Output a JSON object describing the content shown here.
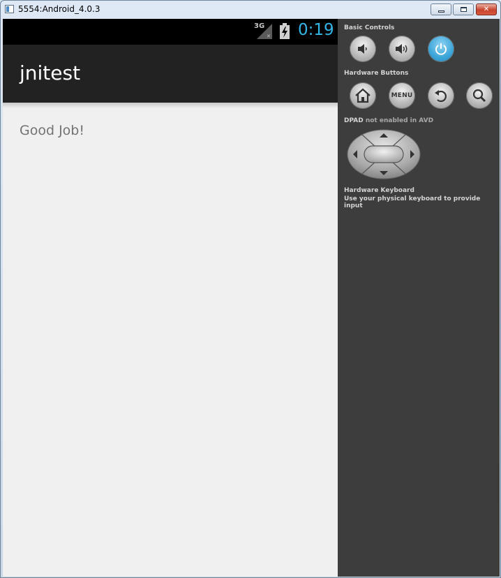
{
  "window": {
    "title": "5554:Android_4.0.3"
  },
  "status_bar": {
    "network_label": "3G",
    "clock": "0:19"
  },
  "app": {
    "title": "jnitest",
    "message": "Good Job!"
  },
  "controls": {
    "basic_controls_label": "Basic Controls",
    "hardware_buttons_label": "Hardware Buttons",
    "menu_button_label": "MENU",
    "dpad_label": "DPAD",
    "dpad_status": "not enabled in AVD",
    "keyboard_label": "Hardware Keyboard",
    "keyboard_desc": "Use your physical keyboard to provide input"
  },
  "colors": {
    "accent": "#33b5e5",
    "action_bar": "#222222",
    "screen_bg": "#f0f0f0",
    "panel_bg": "#3d3d3d",
    "power_button": "#3aa4d8"
  },
  "icons": {
    "volume_down": "volume-down-icon",
    "volume_up": "volume-up-icon",
    "power": "power-icon",
    "home": "home-icon",
    "back": "back-icon",
    "search": "search-icon",
    "battery": "battery-charging-icon",
    "signal": "signal-icon"
  }
}
